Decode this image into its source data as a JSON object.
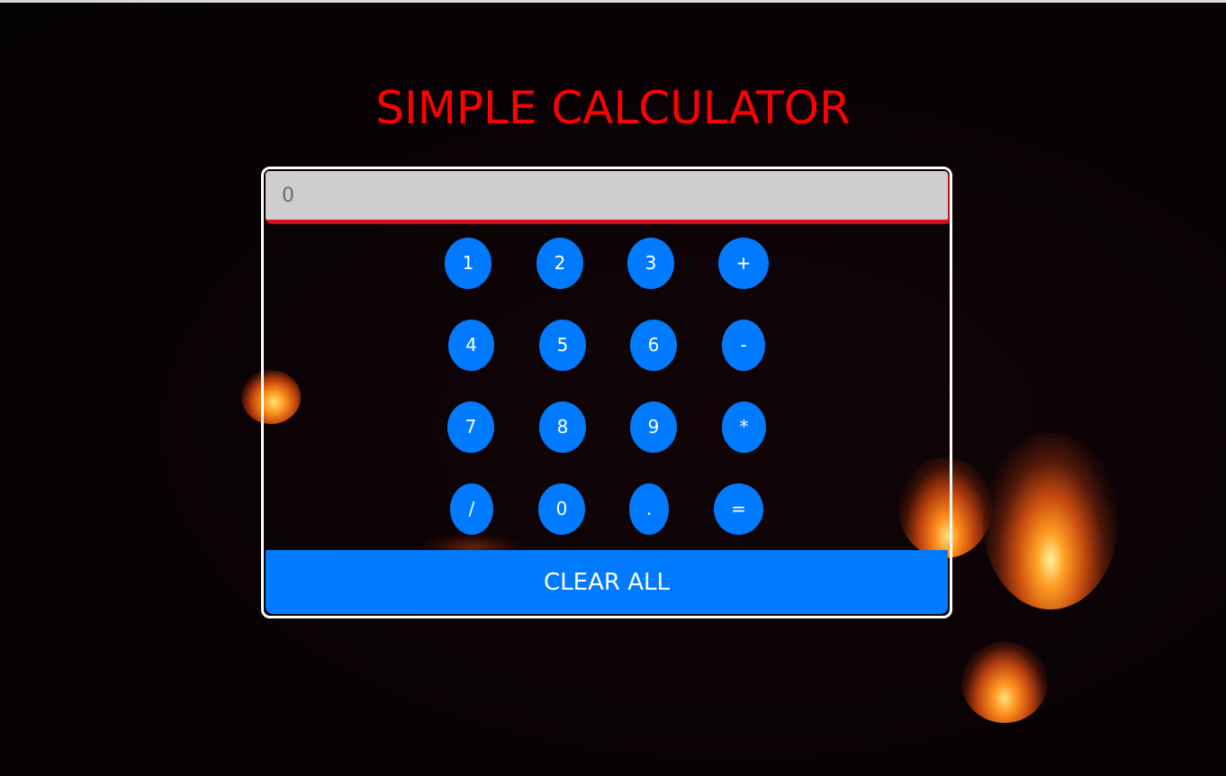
{
  "page": {
    "title": "SIMPLE CALCULATOR"
  },
  "display": {
    "placeholder": "0"
  },
  "keys": {
    "k1": "1",
    "k2": "2",
    "k3": "3",
    "plus": "+",
    "k4": "4",
    "k5": "5",
    "k6": "6",
    "minus": "-",
    "k7": "7",
    "k8": "8",
    "k9": "9",
    "multiply": "*",
    "divide": "/",
    "k0": "0",
    "dot": ".",
    "equals": "="
  },
  "clear": {
    "label": "CLEAR ALL"
  },
  "colors": {
    "title": "#ff0000",
    "button": "#007bff",
    "display_bg": "#cfcdcf",
    "display_border": "#e0101a",
    "frame": "#ffffff"
  },
  "background": {
    "icon": "floating-lanterns-night-image"
  }
}
